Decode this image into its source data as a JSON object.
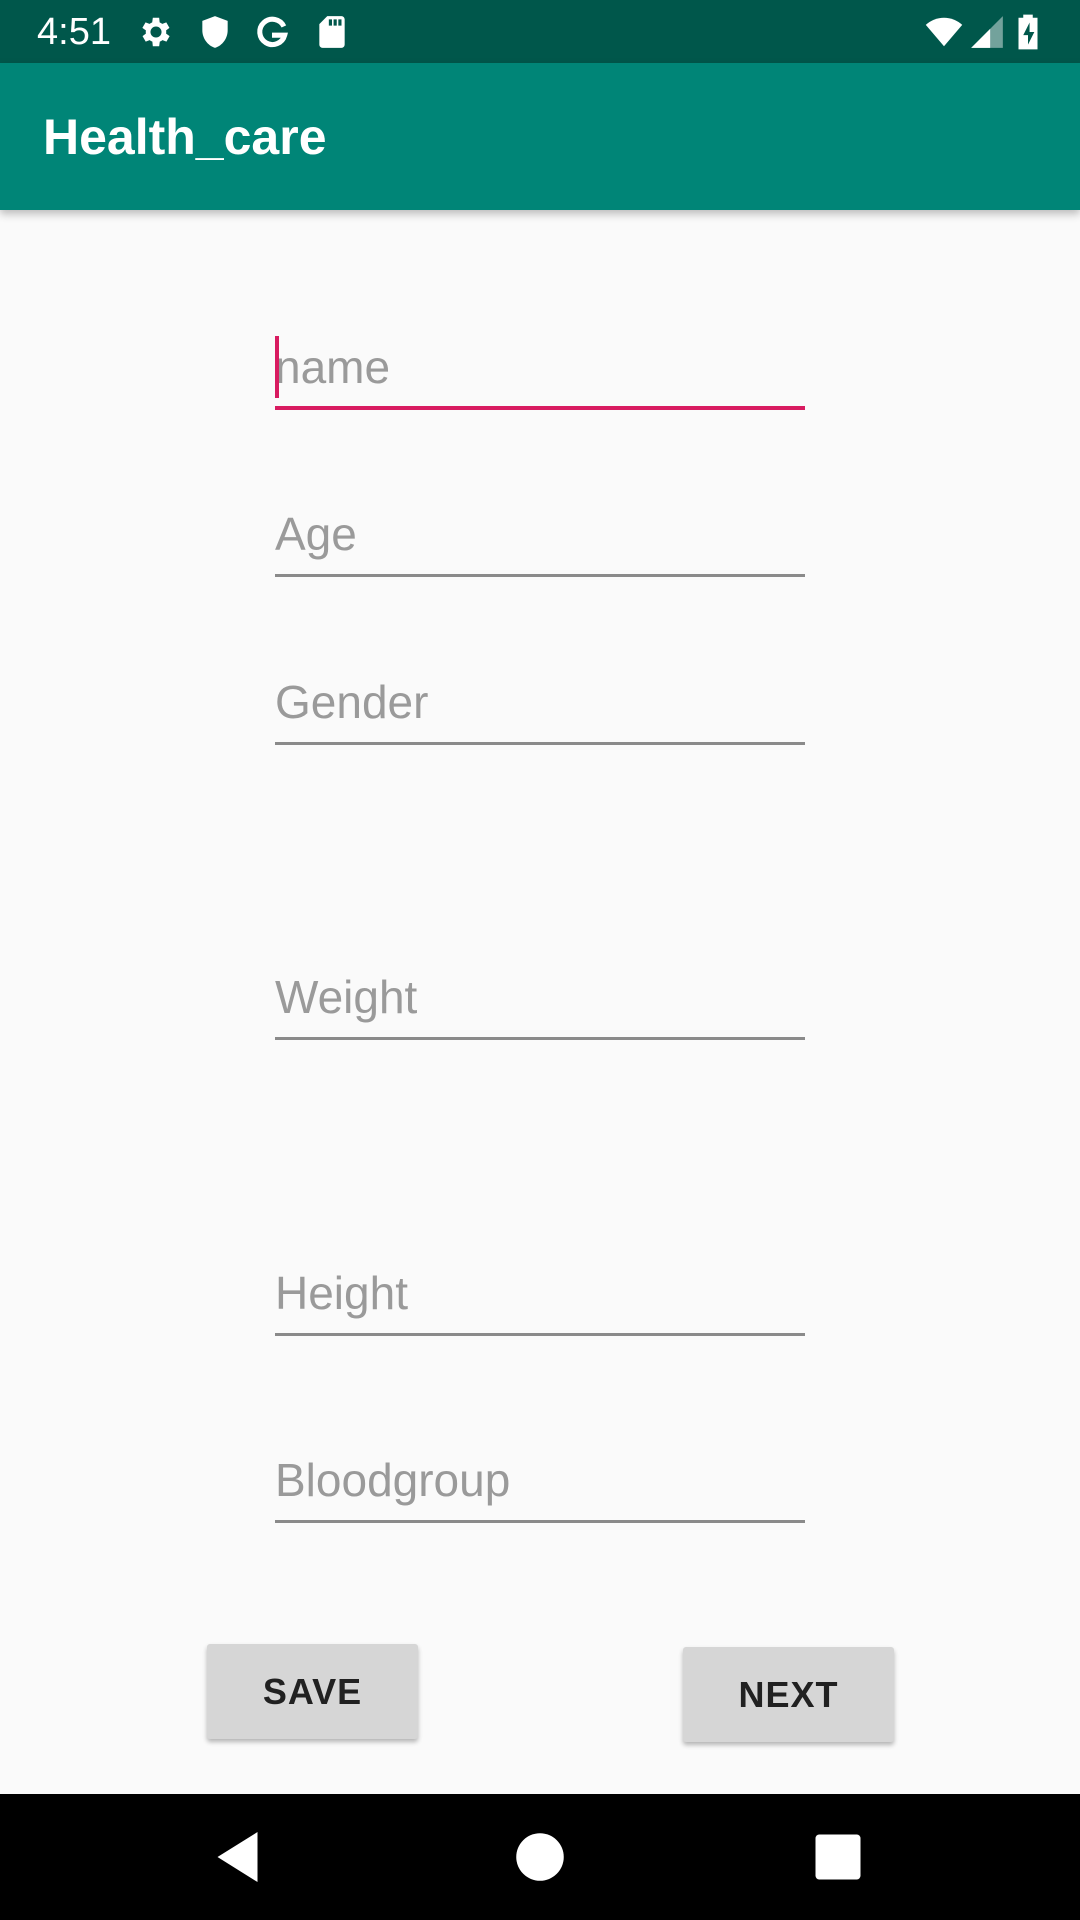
{
  "status_bar": {
    "time": "4:51",
    "left_icons": [
      "settings-icon",
      "shield-icon",
      "google-icon",
      "sd-card-icon"
    ],
    "right_icons": [
      "wifi-icon",
      "cell-signal-icon",
      "battery-charging-icon"
    ]
  },
  "app_bar": {
    "title": "Health_care",
    "color": "#008577"
  },
  "form": {
    "fields": [
      {
        "name": "name",
        "placeholder": "name",
        "value": "",
        "focused": true
      },
      {
        "name": "age",
        "placeholder": "Age",
        "value": ""
      },
      {
        "name": "gender",
        "placeholder": "Gender",
        "value": ""
      },
      {
        "name": "weight",
        "placeholder": "Weight",
        "value": ""
      },
      {
        "name": "height",
        "placeholder": "Height",
        "value": ""
      },
      {
        "name": "bloodgroup",
        "placeholder": "Bloodgroup",
        "value": ""
      }
    ],
    "accent_color": "#d81b60"
  },
  "buttons": {
    "save_label": "SAVE",
    "next_label": "NEXT"
  },
  "nav_bar": {
    "icons": [
      "back-icon",
      "home-icon",
      "recents-icon"
    ]
  }
}
